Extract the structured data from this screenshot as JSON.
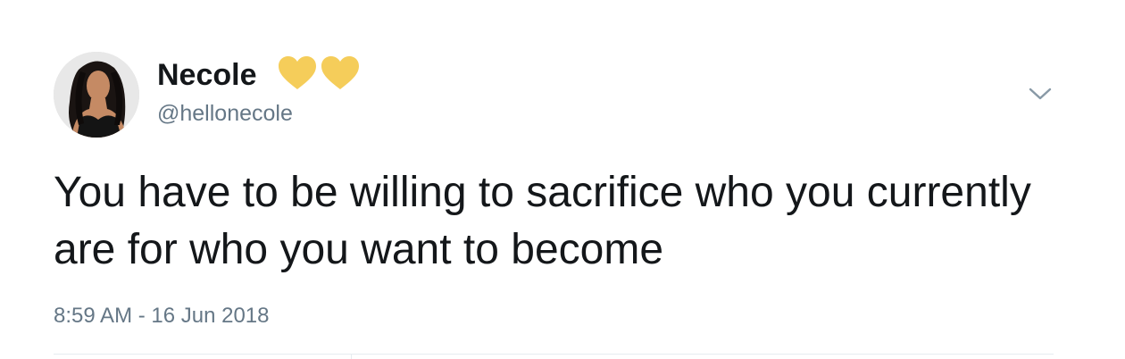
{
  "user": {
    "display_name": "Necole",
    "handle": "@hellonecole",
    "badges": [
      "yellow-heart-icon",
      "yellow-heart-icon"
    ],
    "heart_color": "#f5cd5a"
  },
  "tweet": {
    "text": "You have to be willing to sacrifice who you currently are for who you want to become",
    "timestamp": "8:59 AM - 16 Jun 2018"
  },
  "icons": {
    "menu": "chevron-down-icon"
  },
  "colors": {
    "text": "#14171a",
    "secondary": "#657786",
    "divider": "#e6ecf0"
  }
}
